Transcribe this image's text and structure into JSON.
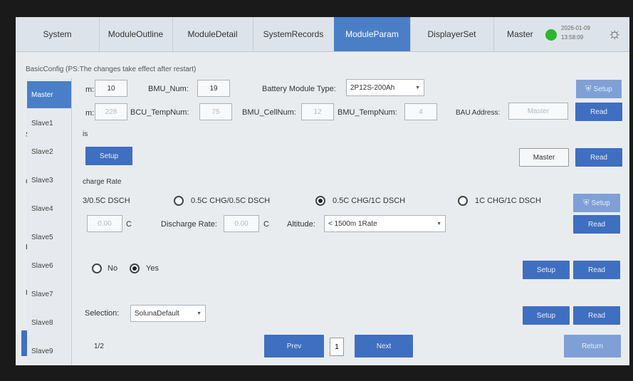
{
  "tabs": [
    "System",
    "ModuleOutline",
    "ModuleDetail",
    "SystemRecords",
    "ModuleParam",
    "DisplayerSet"
  ],
  "status": {
    "role": "Master",
    "date": "2026-01-09",
    "time": "13:58:09"
  },
  "basic_note": "BasicConfig (PS:The changes take effect after restart)",
  "slaves": [
    "Master",
    "Slave1",
    "Slave2",
    "Slave3",
    "Slave4",
    "Slave5",
    "Slave6",
    "Slave7",
    "Slave8",
    "Slave9"
  ],
  "row1": {
    "cut_label": "m:",
    "val1": "10",
    "bmu_num_label": "BMU_Num:",
    "bmu_num": "19",
    "battery_type_label": "Battery Module Type:",
    "battery_type": "2P12S-200Ah",
    "setup": "Setup"
  },
  "row2": {
    "cut_label": "m:",
    "val1": "228",
    "bcu_temp_label": "BCU_TempNum:",
    "bcu_temp": "75",
    "bmu_cell_label": "BMU_CellNum:",
    "bmu_cell": "12",
    "bmu_temp_label": "BMU_TempNum:",
    "bmu_temp": "4",
    "bau_label": "BAU Address:",
    "bau": "Master",
    "read": "Read"
  },
  "row3": {
    "cut_label": "is",
    "setup": "Setup",
    "master": "Master",
    "read": "Read"
  },
  "rate": {
    "title_cut": "charge Rate",
    "opt0": "3/0.5C DSCH",
    "opt1": "0.5C CHG/0.5C DSCH",
    "opt2": "0.5C CHG/1C DSCH",
    "opt3": "1C CHG/1C DSCH",
    "setup": "Setup",
    "charge_val": "0.00",
    "unit1": "C",
    "discharge_label": "Discharge Rate:",
    "discharge_val": "0.00",
    "unit2": "C",
    "altitude_label": "Altitude:",
    "altitude": "< 1500m 1Rate",
    "read": "Read"
  },
  "yesno": {
    "no": "No",
    "yes": "Yes",
    "setup": "Setup",
    "read": "Read"
  },
  "selection": {
    "label": "Selection:",
    "value": "SolunaDefault",
    "setup": "Setup",
    "read": "Read"
  },
  "footer": {
    "page": "1/2",
    "prev": "Prev",
    "current": "1",
    "next": "Next",
    "ret": "Return"
  },
  "side_cut": {
    "s": "S",
    "c": "C",
    "e": "E",
    "h": "H"
  }
}
